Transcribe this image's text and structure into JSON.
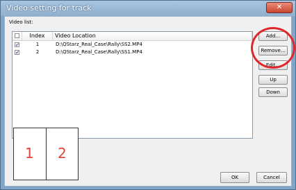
{
  "window": {
    "title": "Video setting for track",
    "close_glyph": "✕"
  },
  "video_list": {
    "label": "Video list:",
    "columns": {
      "index": "Index",
      "location": "Video Location"
    },
    "rows": [
      {
        "checked": "✔",
        "index": "1",
        "location": "D:\\QStarz_Real_Case\\Rally\\SS2.MP4"
      },
      {
        "checked": "✔",
        "index": "2",
        "location": "D:\\QStarz_Real_Case\\Rally\\SS1.MP4"
      }
    ]
  },
  "buttons": {
    "add": "Add...",
    "remove": "Remove...",
    "edit": "Edit...",
    "up": "Up",
    "down": "Down",
    "ok": "OK",
    "cancel": "Cancel"
  },
  "preview": {
    "panel1": "1",
    "panel2": "2"
  },
  "annotation_color": "#e0262a"
}
